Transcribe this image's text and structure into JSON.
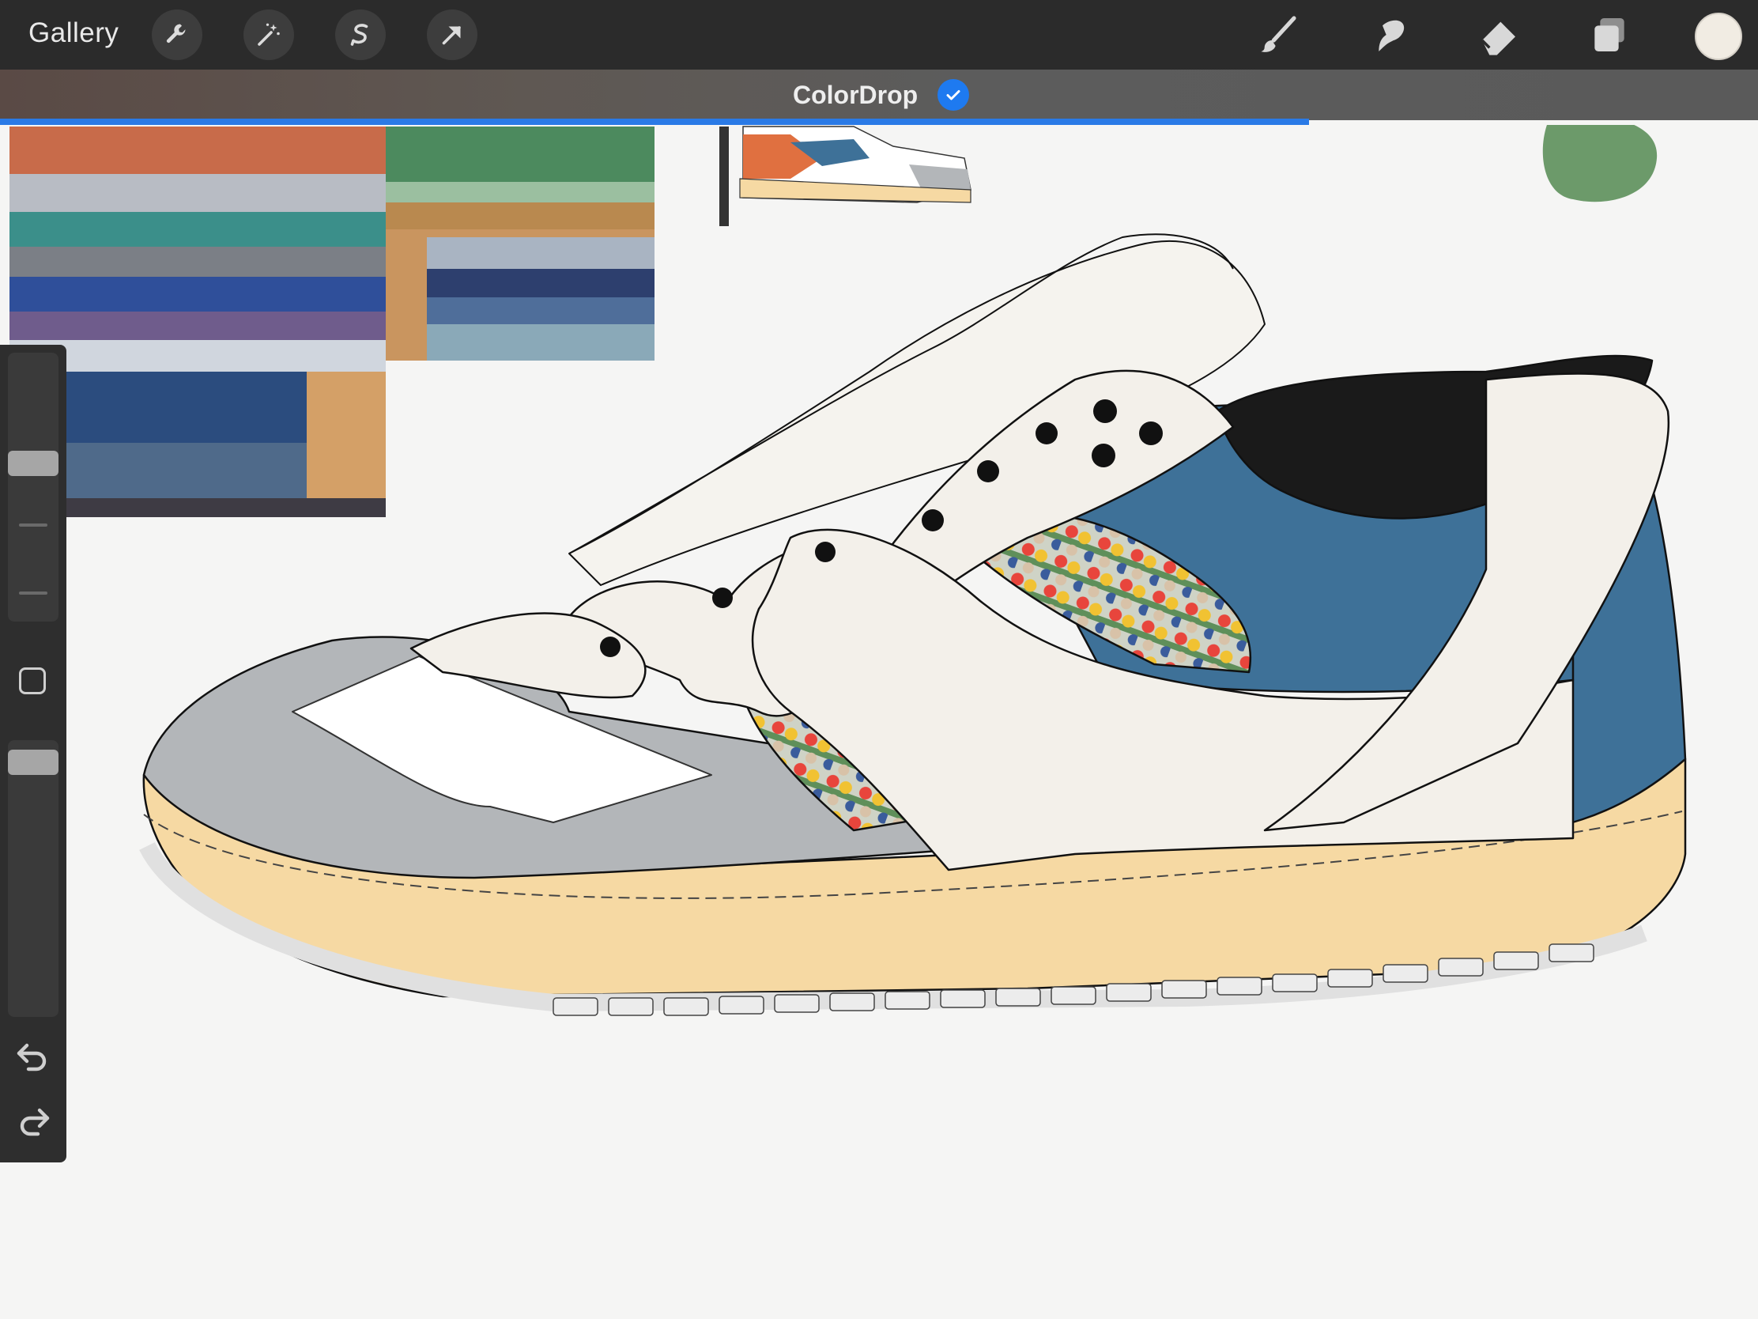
{
  "app": {
    "gallery_label": "Gallery"
  },
  "toolbar": {
    "left_tools": [
      "wrench-icon",
      "magic-wand-icon",
      "selection-s-icon",
      "transform-arrow-icon"
    ],
    "right_tools": [
      "brush-icon",
      "smudge-icon",
      "eraser-icon",
      "layers-icon"
    ],
    "current_color": "#f1ece3"
  },
  "notification": {
    "text": "ColorDrop",
    "status": "check-icon",
    "progress_color": "#2a7ae6"
  },
  "colors": {
    "toolbar_bg": "#2b2b2b",
    "canvas_bg": "#f5f5f4",
    "shoe_blue": "#3e7198",
    "shoe_cream": "#f3f0ea",
    "shoe_grey": "#b3b6b9",
    "sole_yellow": "#f6d9a3",
    "heel_black": "#1a1a1a",
    "blob_green": "#6c9a6a"
  }
}
